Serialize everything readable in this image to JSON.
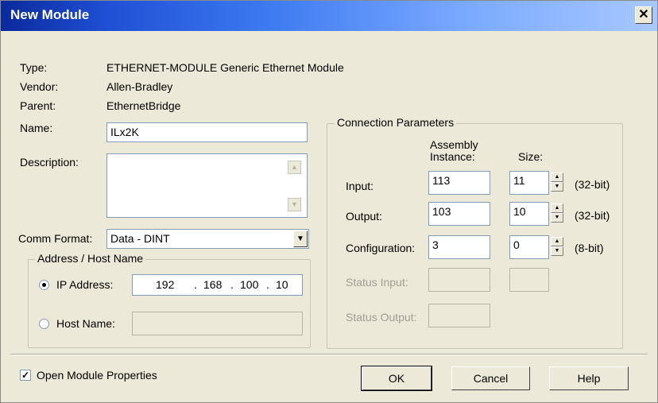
{
  "window": {
    "title": "New Module",
    "close_glyph": "✕"
  },
  "info": {
    "type_label": "Type:",
    "type_value": "ETHERNET-MODULE Generic Ethernet Module",
    "vendor_label": "Vendor:",
    "vendor_value": "Allen-Bradley",
    "parent_label": "Parent:",
    "parent_value": "EthernetBridge"
  },
  "name": {
    "label": "Name:",
    "value": "ILx2K"
  },
  "description": {
    "label": "Description:",
    "value": ""
  },
  "comm_format": {
    "label": "Comm Format:",
    "value": "Data - DINT"
  },
  "address": {
    "group_title": "Address / Host Name",
    "ip_label": "IP Address:",
    "ip_octets": [
      "192",
      "168",
      "100",
      "10"
    ],
    "host_label": "Host Name:",
    "host_value": "",
    "selected": "ip"
  },
  "connection": {
    "group_title": "Connection Parameters",
    "assembly_header": [
      "Assembly",
      "Instance:"
    ],
    "size_header": "Size:",
    "rows": [
      {
        "label": "Input:",
        "instance": "113",
        "size": "11",
        "unit": "(32-bit)",
        "enabled": true
      },
      {
        "label": "Output:",
        "instance": "103",
        "size": "10",
        "unit": "(32-bit)",
        "enabled": true
      },
      {
        "label": "Configuration:",
        "instance": "3",
        "size": "0",
        "unit": "(8-bit)",
        "enabled": true
      },
      {
        "label": "Status Input:",
        "instance": "",
        "size": "",
        "unit": "",
        "enabled": false
      },
      {
        "label": "Status Output:",
        "instance": "",
        "size": "",
        "unit": "",
        "enabled": false
      }
    ]
  },
  "open_props": {
    "label": "Open Module Properties",
    "checked": true
  },
  "buttons": {
    "ok": "OK",
    "cancel": "Cancel",
    "help": "Help"
  }
}
